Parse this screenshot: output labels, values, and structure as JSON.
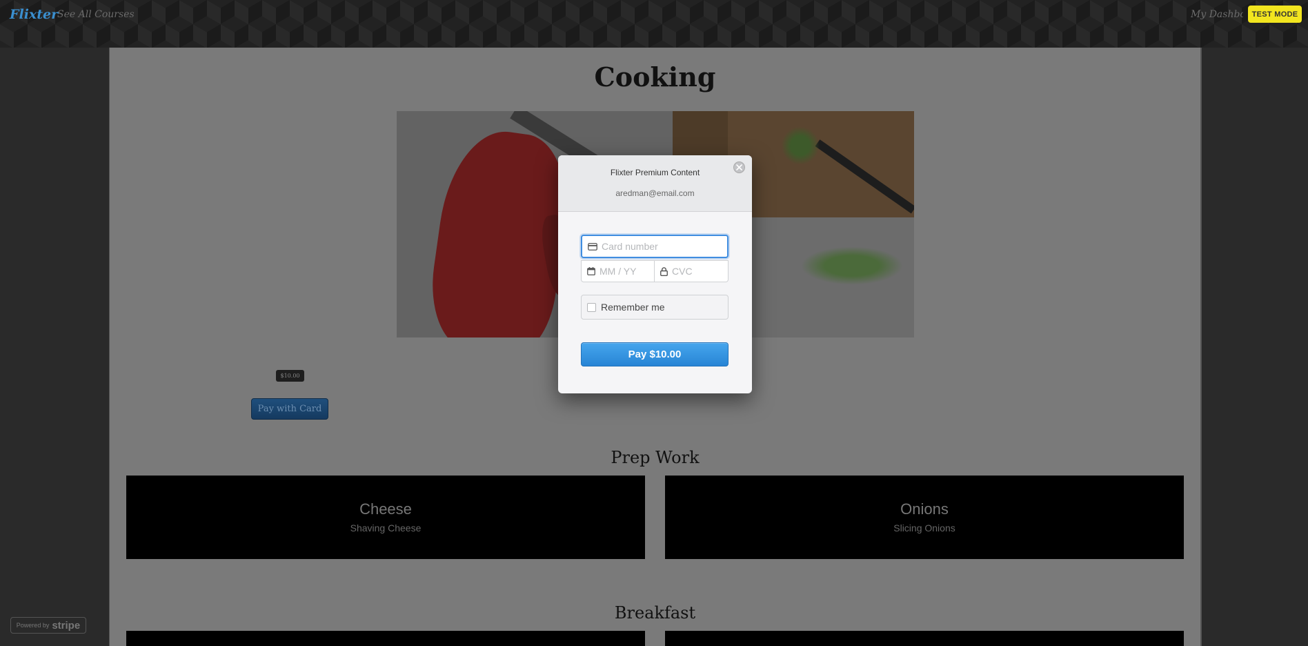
{
  "nav": {
    "brand": "Flixter",
    "see_all": "See All Courses",
    "dashboard": "My Dashboard",
    "test_mode": "TEST MODE"
  },
  "course": {
    "title": "Cooking",
    "price": "$10.00",
    "pay_button": "Pay with Card"
  },
  "sections": [
    {
      "title": "Prep Work",
      "lessons": [
        {
          "title": "Cheese",
          "subtitle": "Shaving Cheese"
        },
        {
          "title": "Onions",
          "subtitle": "Slicing Onions"
        }
      ]
    },
    {
      "title": "Breakfast",
      "lessons": []
    }
  ],
  "footer": {
    "powered_by": "Powered by",
    "stripe": "stripe"
  },
  "checkout": {
    "title": "Flixter Premium Content",
    "email": "aredman@email.com",
    "card_number_placeholder": "Card number",
    "expiry_placeholder": "MM / YY",
    "cvc_placeholder": "CVC",
    "remember_me": "Remember me",
    "pay_label": "Pay $10.00"
  },
  "icons": {
    "close": "close-icon",
    "card": "credit-card-icon",
    "calendar": "calendar-icon",
    "lock": "lock-icon"
  },
  "colors": {
    "accent": "#3f8de0",
    "pay_button": "#2f8fe0",
    "test_mode": "#f2e51f",
    "brand": "#3a8fd0"
  }
}
